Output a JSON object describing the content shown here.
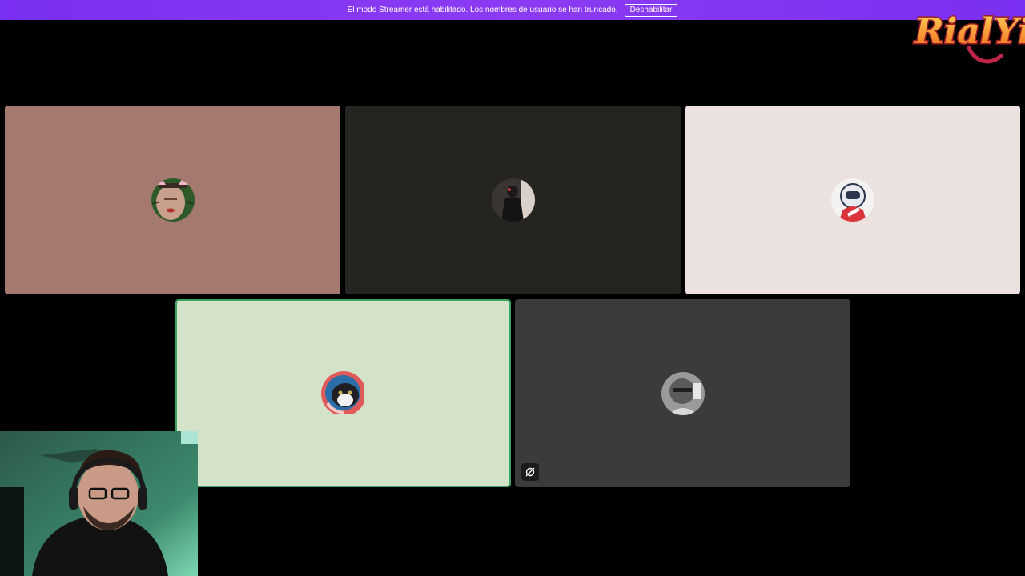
{
  "banner": {
    "message": "El modo Streamer está habilitado. Los nombres de usuario se han truncado.",
    "button_label": "Deshabilitar",
    "color": "#7b2ff0"
  },
  "logo": {
    "text": "RialYi"
  },
  "tiles": [
    {
      "bg": "#a57870",
      "avatar_icon": "cat-ears-face-avatar",
      "speaking": false,
      "muted": false
    },
    {
      "bg": "#262420",
      "avatar_icon": "dark-figure-avatar",
      "speaking": false,
      "muted": false
    },
    {
      "bg": "#ebe1df",
      "avatar_icon": "cartoon-helmet-avatar",
      "speaking": false,
      "muted": false
    },
    {
      "bg": "#d5e2ca",
      "avatar_icon": "cat-avatar",
      "speaking": true,
      "muted": false,
      "speaking_color": "#3ba55d"
    },
    {
      "bg": "#3b3b3b",
      "avatar_icon": "grayscale-face-avatar",
      "speaking": false,
      "muted": true
    }
  ],
  "webcam": {
    "icon": "streamer-webcam-feed"
  }
}
